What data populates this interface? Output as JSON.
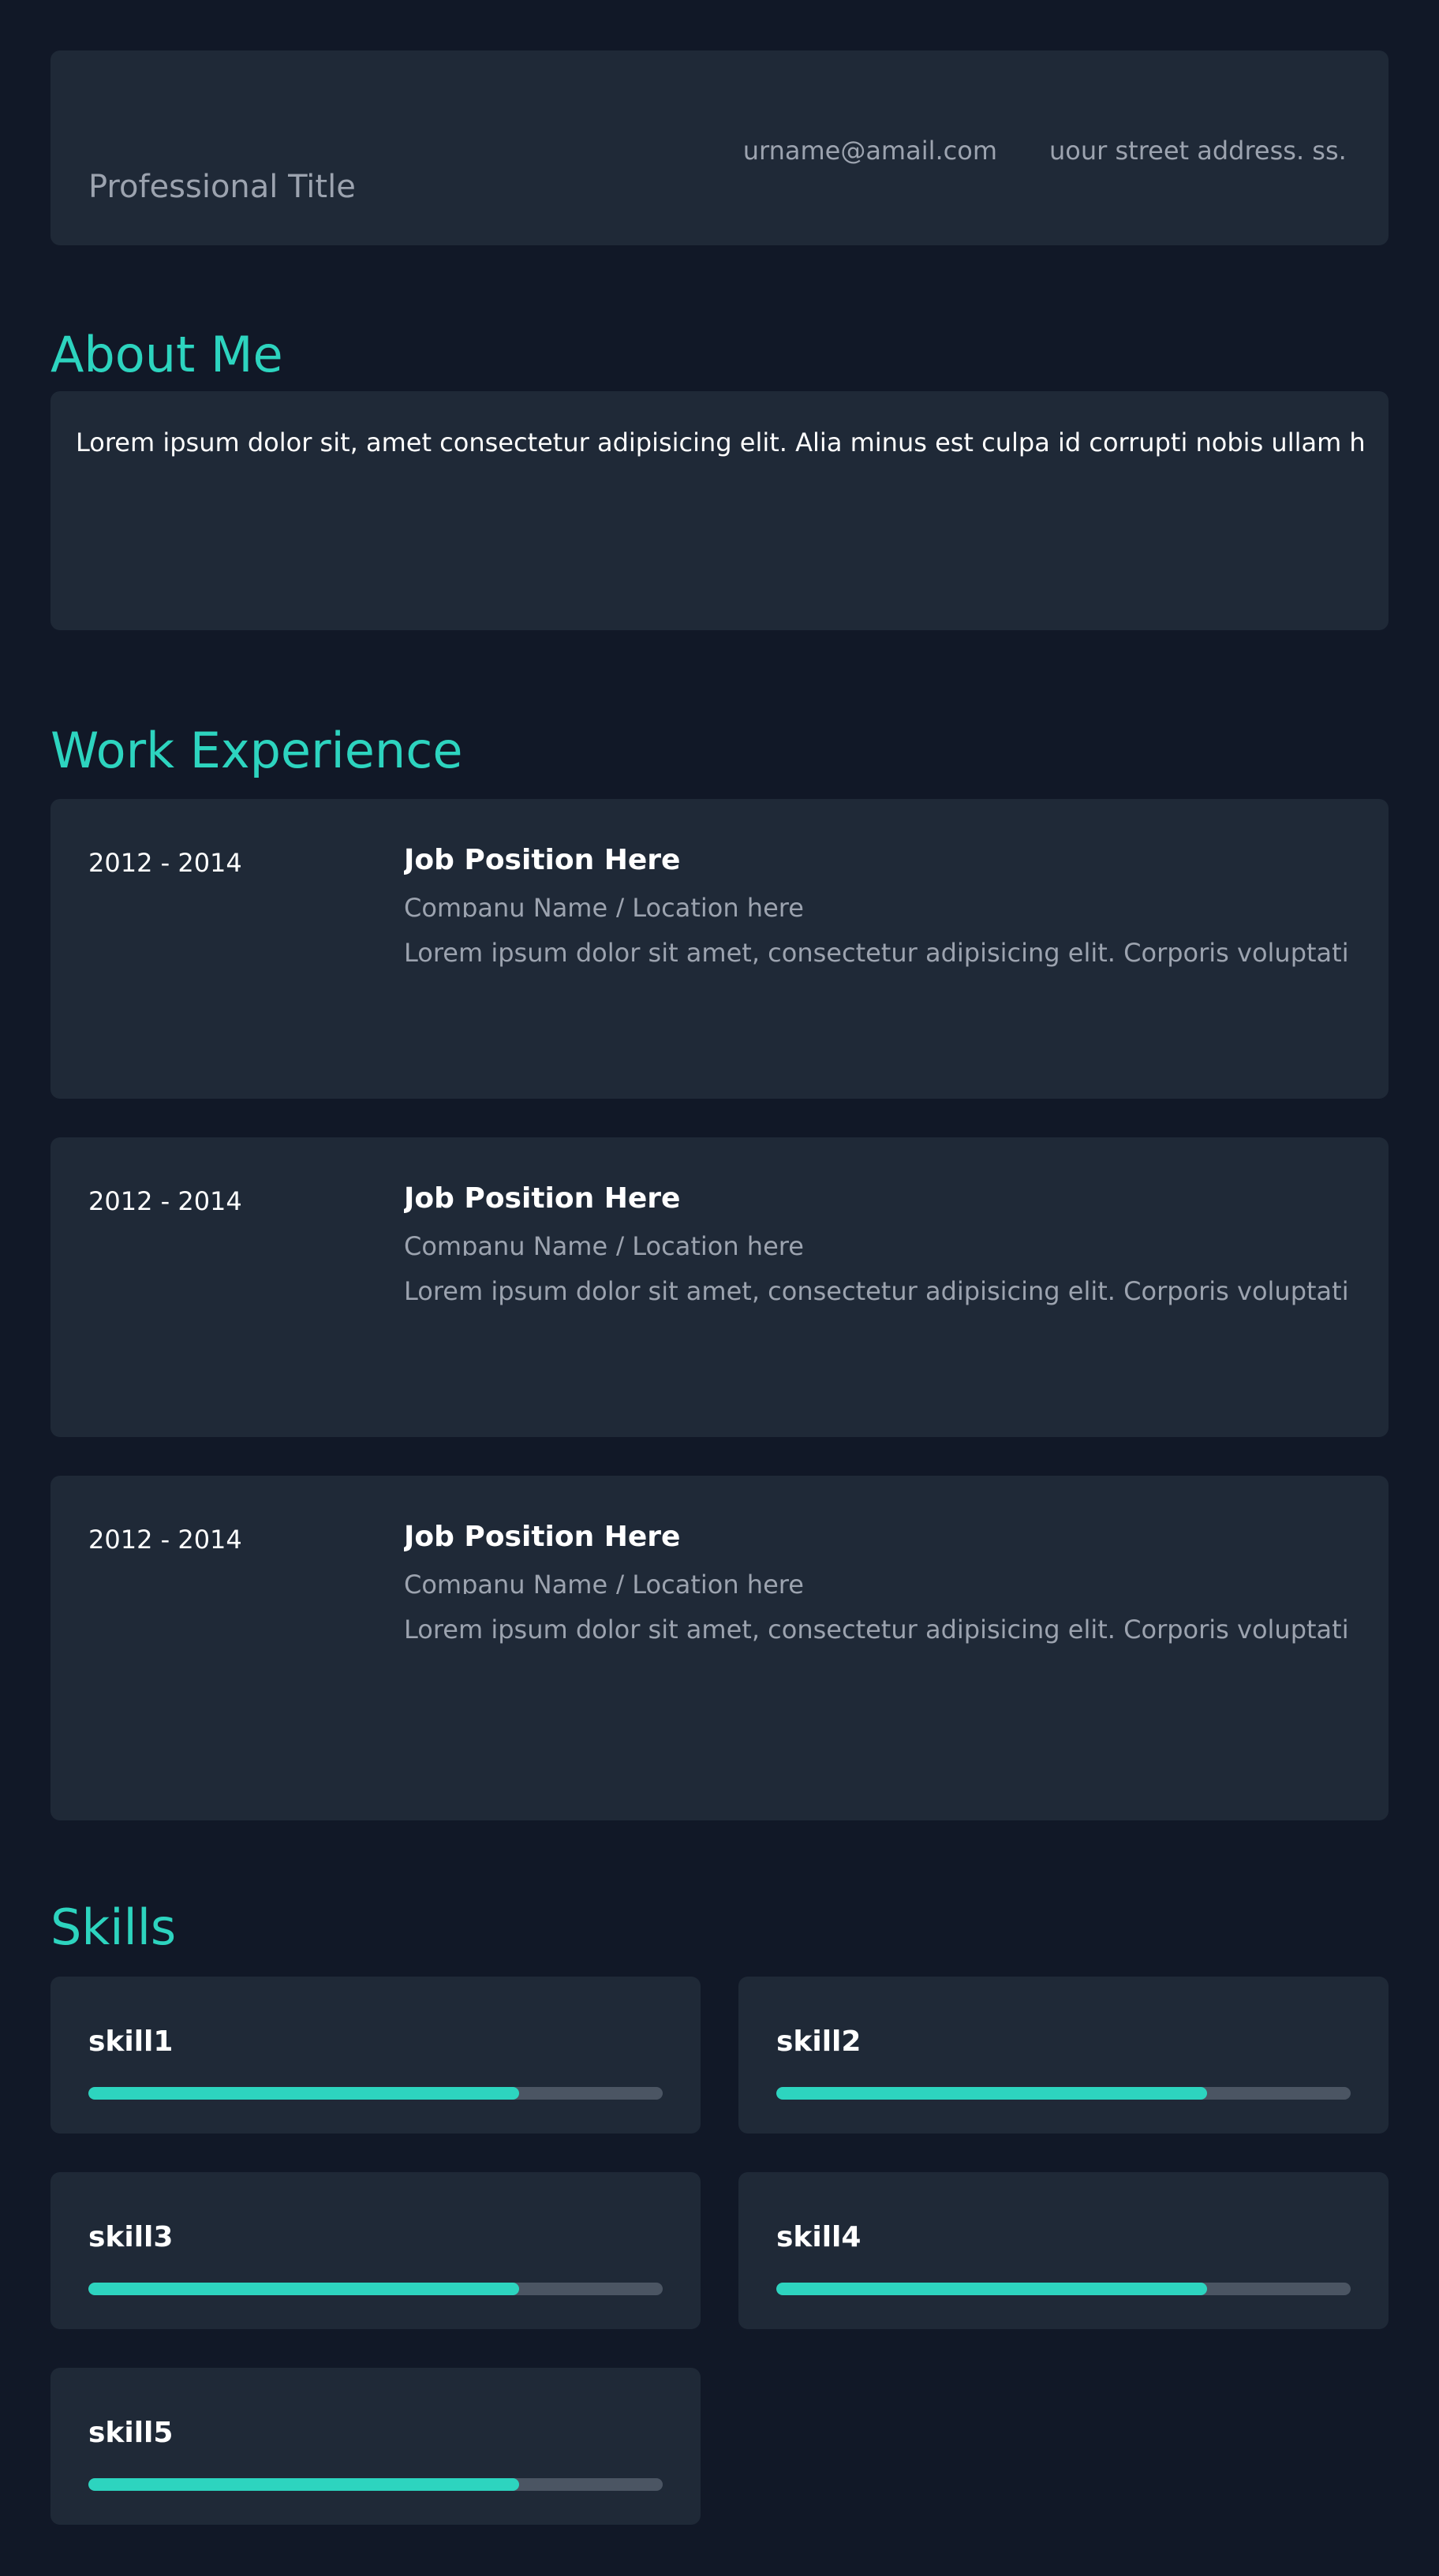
{
  "header": {
    "professional_title": "Professional Title",
    "email": "urname@amail.com",
    "address": "uour street address. ss. st"
  },
  "about": {
    "heading": "About Me",
    "text": "Lorem ipsum dolor sit, amet consectetur adipisicing elit. Alia minus est culpa id corrupti nobis ullam harum"
  },
  "experience": {
    "heading": "Work Experience",
    "jobs": [
      {
        "years": "2012 - 2014",
        "position": "Job Position Here",
        "company": "Companu Name / Location here",
        "description": "Lorem ipsum dolor sit amet, consectetur adipisicing elit. Corporis voluptatibus"
      },
      {
        "years": "2012 - 2014",
        "position": "Job Position Here",
        "company": "Companu Name / Location here",
        "description": "Lorem ipsum dolor sit amet, consectetur adipisicing elit. Corporis voluptatibus"
      },
      {
        "years": "2012 - 2014",
        "position": "Job Position Here",
        "company": "Companu Name / Location here",
        "description": "Lorem ipsum dolor sit amet, consectetur adipisicing elit. Corporis voluptatibus"
      }
    ]
  },
  "skills": {
    "heading": "Skills",
    "items": [
      {
        "name": "skill1",
        "level": 0.75
      },
      {
        "name": "skill2",
        "level": 0.75
      },
      {
        "name": "skill3",
        "level": 0.75
      },
      {
        "name": "skill4",
        "level": 0.75
      },
      {
        "name": "skill5",
        "level": 0.75
      }
    ]
  },
  "colors": {
    "background": "#111827",
    "card": "#1f2937",
    "accent": "#2dd4bf",
    "muted_text": "#9ca3af",
    "track": "#4b5563"
  }
}
